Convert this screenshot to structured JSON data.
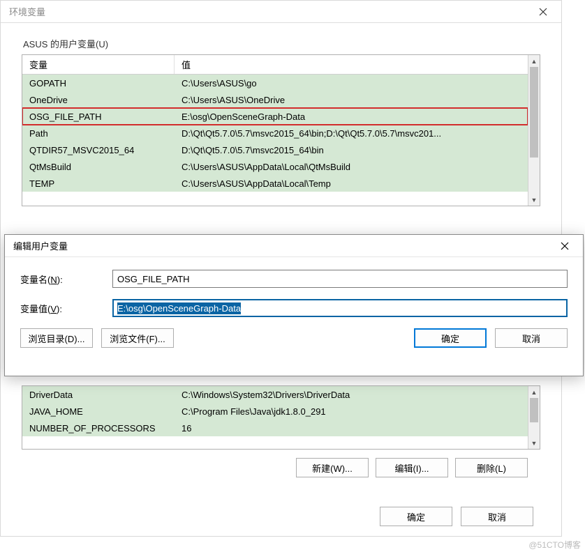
{
  "parentDialog": {
    "title": "环境变量",
    "userVars": {
      "groupLabel": "ASUS 的用户变量(U)",
      "columns": {
        "var": "变量",
        "val": "值"
      },
      "rows": [
        {
          "var": "GOPATH",
          "val": "C:\\Users\\ASUS\\go",
          "highlight": false
        },
        {
          "var": "OneDrive",
          "val": "C:\\Users\\ASUS\\OneDrive",
          "highlight": false
        },
        {
          "var": "OSG_FILE_PATH",
          "val": "E:\\osg\\OpenSceneGraph-Data",
          "highlight": true
        },
        {
          "var": "Path",
          "val": "D:\\Qt\\Qt5.7.0\\5.7\\msvc2015_64\\bin;D:\\Qt\\Qt5.7.0\\5.7\\msvc201...",
          "highlight": false
        },
        {
          "var": "QTDIR57_MSVC2015_64",
          "val": "D:\\Qt\\Qt5.7.0\\5.7\\msvc2015_64\\bin",
          "highlight": false
        },
        {
          "var": "QtMsBuild",
          "val": "C:\\Users\\ASUS\\AppData\\Local\\QtMsBuild",
          "highlight": false
        },
        {
          "var": "TEMP",
          "val": "C:\\Users\\ASUS\\AppData\\Local\\Temp",
          "highlight": false
        }
      ]
    },
    "sysVars": {
      "rows": [
        {
          "var": "DriverData",
          "val": "C:\\Windows\\System32\\Drivers\\DriverData"
        },
        {
          "var": "JAVA_HOME",
          "val": "C:\\Program Files\\Java\\jdk1.8.0_291"
        },
        {
          "var": "NUMBER_OF_PROCESSORS",
          "val": "16"
        }
      ]
    },
    "buttons": {
      "new": "新建(W)...",
      "edit": "编辑(I)...",
      "delete": "删除(L)",
      "ok": "确定",
      "cancel": "取消"
    }
  },
  "editDialog": {
    "title": "编辑用户变量",
    "labels": {
      "nameLabel": "变量名",
      "nameKey": "N",
      "valueLabel": "变量值",
      "valueKey": "V"
    },
    "fields": {
      "name": "OSG_FILE_PATH",
      "value": "E:\\osg\\OpenSceneGraph-Data"
    },
    "buttons": {
      "browseDir": "浏览目录(D)...",
      "browseFile": "浏览文件(F)...",
      "ok": "确定",
      "cancel": "取消"
    }
  },
  "watermark": "@51CTO博客"
}
